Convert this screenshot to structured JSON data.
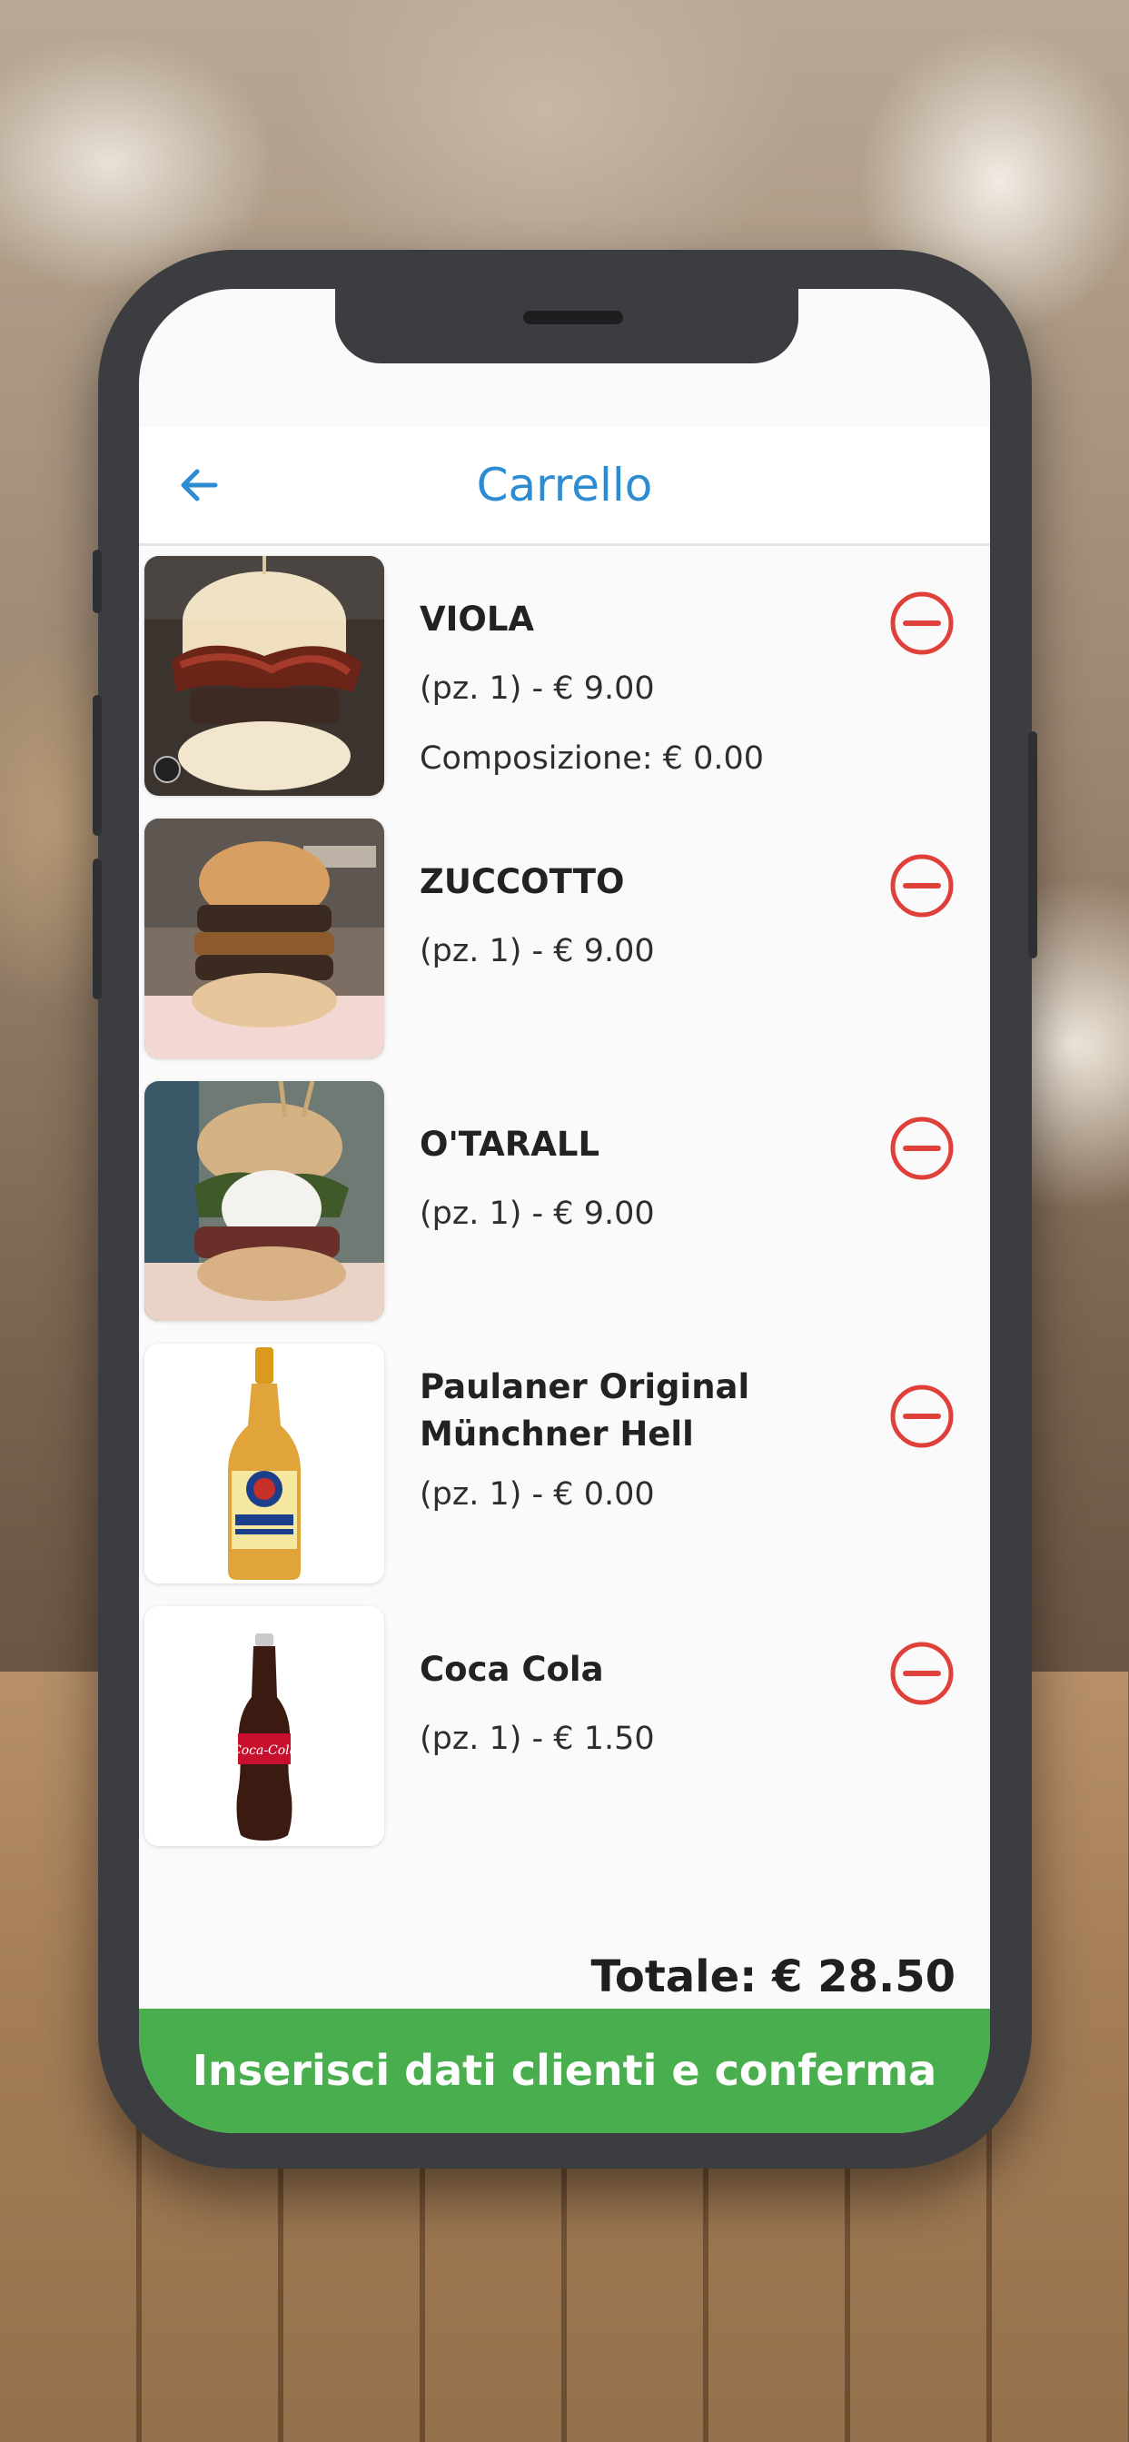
{
  "header": {
    "title": "Carrello"
  },
  "items": [
    {
      "name": "VIOLA",
      "qty_price": "(pz. 1) - € 9.00",
      "extra": "Composizione: € 0.00",
      "image": "burger-viola"
    },
    {
      "name": "ZUCCOTTO",
      "qty_price": "(pz. 1) - € 9.00",
      "image": "burger-zuccotto"
    },
    {
      "name": "O'TARALL",
      "qty_price": "(pz. 1) - € 9.00",
      "image": "burger-otarall"
    },
    {
      "name_line1": "Paulaner Original",
      "name_line2": "Münchner Hell",
      "qty_price": "(pz. 1) - € 0.00",
      "image": "beer-bottle"
    },
    {
      "name": "Coca Cola",
      "qty_price": "(pz. 1) - € 1.50",
      "image": "cola-bottle"
    }
  ],
  "total": "Totale: € 28.50",
  "confirm_button": "Inserisci dati clienti e conferma",
  "colors": {
    "accent": "#2d8bd1",
    "remove": "#e0403a",
    "confirm": "#49ae4e"
  }
}
